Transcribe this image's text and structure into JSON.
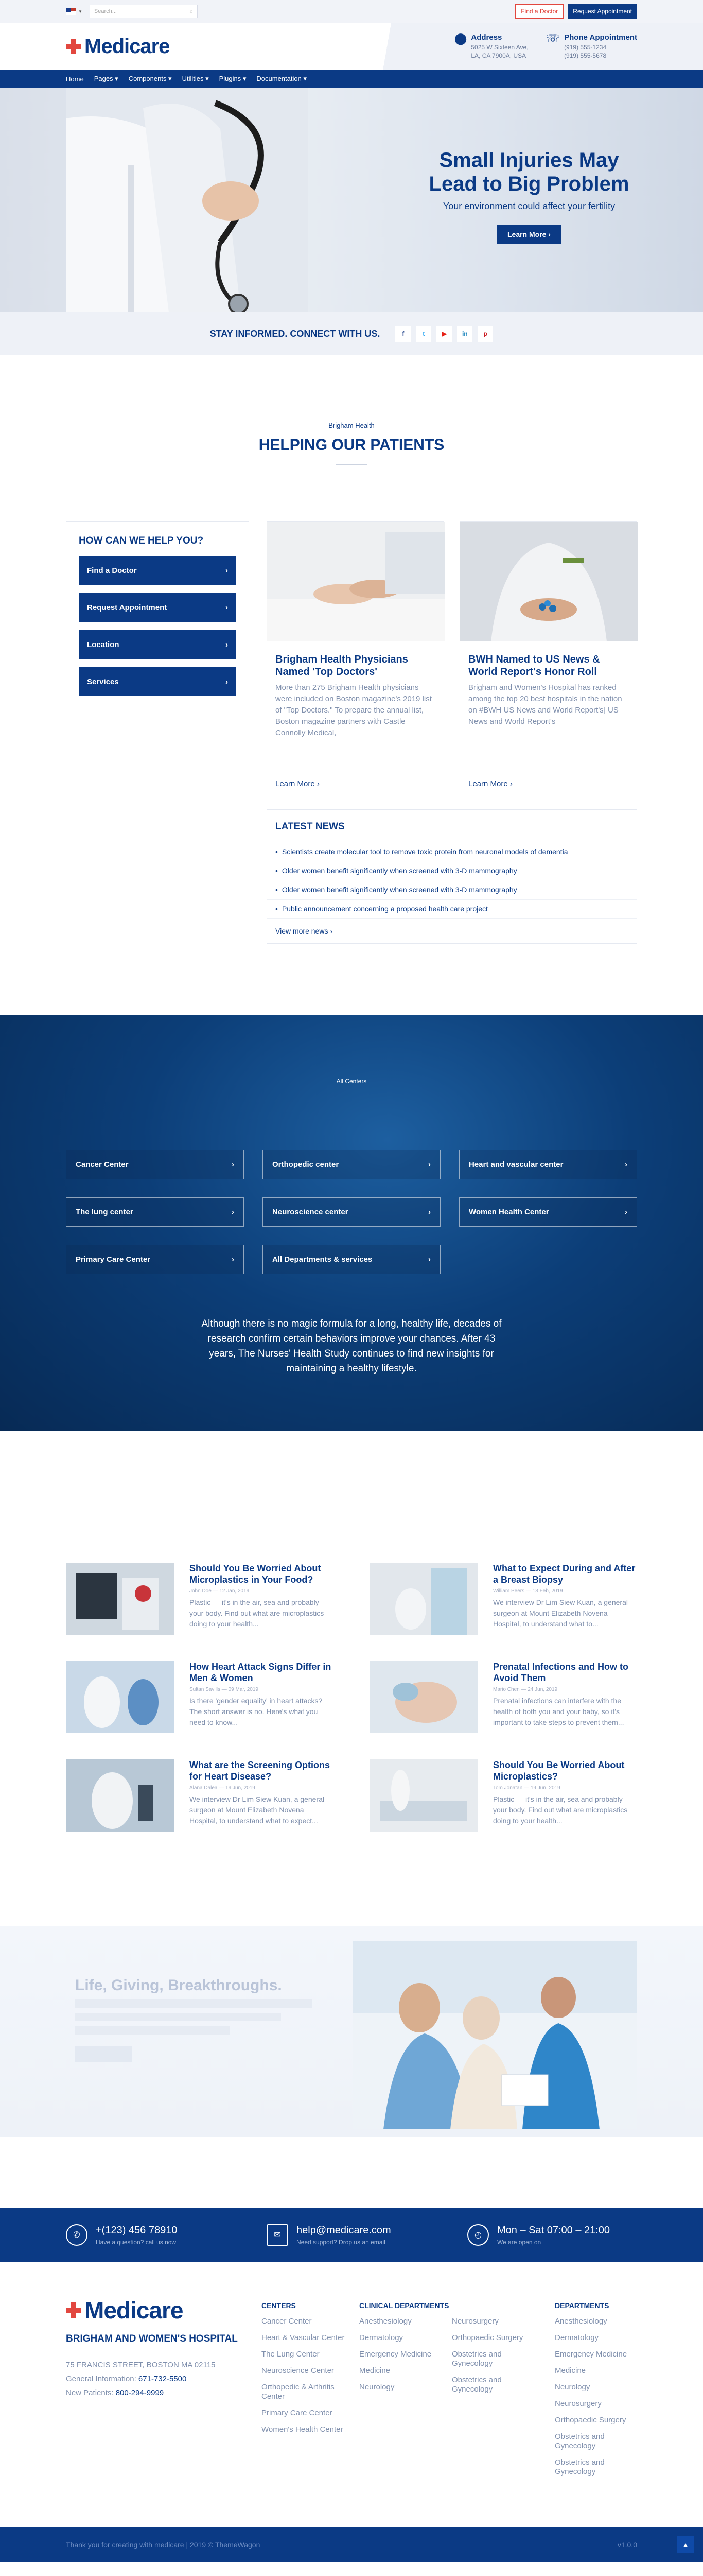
{
  "topbar": {
    "search_placeholder": "Search...",
    "find_doctor": "Find a Doctor",
    "request_appointment": "Request Appointment"
  },
  "brand": {
    "logo_text": "Medicare",
    "accent": "#e2473f",
    "primary": "#0b3a85"
  },
  "header": {
    "address_title": "Address",
    "address_line1": "5025 W Sixteen Ave,",
    "address_line2": "LA, CA 7900A, USA",
    "phone_title": "Phone Appointment",
    "phone_line1": "(919) 555-1234",
    "phone_line2": "(919) 555-5678"
  },
  "nav": {
    "items": [
      "Home",
      "Pages",
      "Components",
      "Utilities",
      "Plugins",
      "Documentation"
    ]
  },
  "hero": {
    "title_line1": "Small Injuries May",
    "title_line2": "Lead to Big Problem",
    "subtitle": "Your environment could affect your fertility",
    "button": "Learn More"
  },
  "social": {
    "title": "STAY INFORMED. CONNECT WITH US.",
    "icons": [
      "f",
      "t",
      "▶",
      "in",
      "p"
    ]
  },
  "helping": {
    "small": "Brigham Health",
    "title": "HELPING OUR PATIENTS"
  },
  "help_box": {
    "title": "HOW CAN WE HELP YOU?",
    "items": [
      "Find a Doctor",
      "Request Appointment",
      "Location",
      "Services"
    ]
  },
  "cards": [
    {
      "title": "Brigham Health Physicians Named 'Top Doctors'",
      "text": "More than 275 Brigham Health physicians were included on Boston magazine's 2019 list of \"Top Doctors.\" To prepare the annual list, Boston magazine partners with Castle Connolly Medical,",
      "more": "Learn More"
    },
    {
      "title": "BWH Named to US News & World Report's Honor Roll",
      "text": "Brigham and Women's Hospital has ranked among the top 20 best hospitals in the nation on #BWH US News and World Report's] US News and World Report's",
      "more": "Learn More"
    }
  ],
  "news": {
    "title": "LATEST NEWS",
    "items": [
      "Scientists create molecular tool to remove toxic protein from neuronal models of dementia",
      "Older women benefit significantly when screened with 3-D mammography",
      "Older women benefit significantly when screened with 3-D mammography",
      "Public announcement concerning a proposed health care project"
    ],
    "view_more": "View more news"
  },
  "centers": {
    "small": "All Centers",
    "items": [
      "Cancer Center",
      "Orthopedic center",
      "Heart and vascular center",
      "The lung center",
      "Neuroscience center",
      "Women Health Center",
      "Primary Care Center",
      "All Departments & services"
    ],
    "quote": "Although there is no magic formula for a long, healthy life, decades of research confirm certain behaviors improve your chances. After 43 years, The Nurses' Health Study continues to find new insights for maintaining a healthy lifestyle."
  },
  "articles": [
    {
      "title": "Should You Be Worried About Microplastics in Your Food?",
      "meta": "John Doe — 12 Jan, 2019",
      "text": "Plastic — it's in the air, sea and probably your body. Find out what are microplastics doing to your health..."
    },
    {
      "title": "What to Expect During and After a Breast Biopsy",
      "meta": "William Peers — 13 Feb, 2019",
      "text": "We interview Dr Lim Siew Kuan, a general surgeon at Mount Elizabeth Novena Hospital, to understand what to..."
    },
    {
      "title": "How Heart Attack Signs Differ in Men & Women",
      "meta": "Sultan Savills — 09 Mar, 2019",
      "text": "Is there 'gender equality' in heart attacks? The short answer is no. Here's what you need to know..."
    },
    {
      "title": "Prenatal Infections and How to Avoid Them",
      "meta": "Mario Chen — 24 Jun, 2019",
      "text": "Prenatal infections can interfere with the health of both you and your baby, so it's important to take steps to prevent them..."
    },
    {
      "title": "What are the Screening Options for Heart Disease?",
      "meta": "Alana Dalea — 19 Jun, 2019",
      "text": "We interview Dr Lim Siew Kuan, a general surgeon at Mount Elizabeth Novena Hospital, to understand what to expect..."
    },
    {
      "title": "Should You Be Worried About Microplastics?",
      "meta": "Tom Jonatan — 19 Jun, 2019",
      "text": "Plastic — it's in the air, sea and probably your body. Find out what are microplastics doing to your health..."
    }
  ],
  "life": {
    "title": "Life, Giving, Breakthroughs."
  },
  "contact_band": [
    {
      "title": "+(123) 456 78910",
      "sub": "Have a question? call us now"
    },
    {
      "title": "help@medicare.com",
      "sub": "Need support? Drop us an email"
    },
    {
      "title": "Mon – Sat 07:00 – 21:00",
      "sub": "We are open on"
    }
  ],
  "footer": {
    "name": "BRIGHAM AND WOMEN'S HOSPITAL",
    "address": "75 FRANCIS STREET, BOSTON MA 02115",
    "general_label": "General Information:",
    "general_phone": "671-732-5500",
    "patients_label": "New Patients:",
    "patients_phone": "800-294-9999",
    "centers_title": "CENTERS",
    "centers": [
      "Cancer Center",
      "Heart & Vascular Center",
      "The Lung Center",
      "Neuroscience Center",
      "Orthopedic & Arthritis Center",
      "Primary Care Center",
      "Women's Health Center"
    ],
    "clinical_title": "CLINICAL DEPARTMENTS",
    "clinical_a": [
      "Anesthesiology",
      "Dermatology",
      "Emergency Medicine",
      "Medicine",
      "Neurology"
    ],
    "clinical_b": [
      "Neurosurgery",
      "Orthopaedic Surgery",
      "Obstetrics and Gynecology",
      "Obstetrics and Gynecology"
    ],
    "departments_title": "DEPARTMENTS",
    "departments": [
      "Anesthesiology",
      "Dermatology",
      "Emergency Medicine",
      "Medicine",
      "Neurology",
      "Neurosurgery",
      "Orthopaedic Surgery",
      "Obstetrics and Gynecology",
      "Obstetrics and Gynecology"
    ],
    "copyright": "Thank you for creating with medicare | 2019 © ThemeWagon",
    "version": "v1.0.0"
  }
}
